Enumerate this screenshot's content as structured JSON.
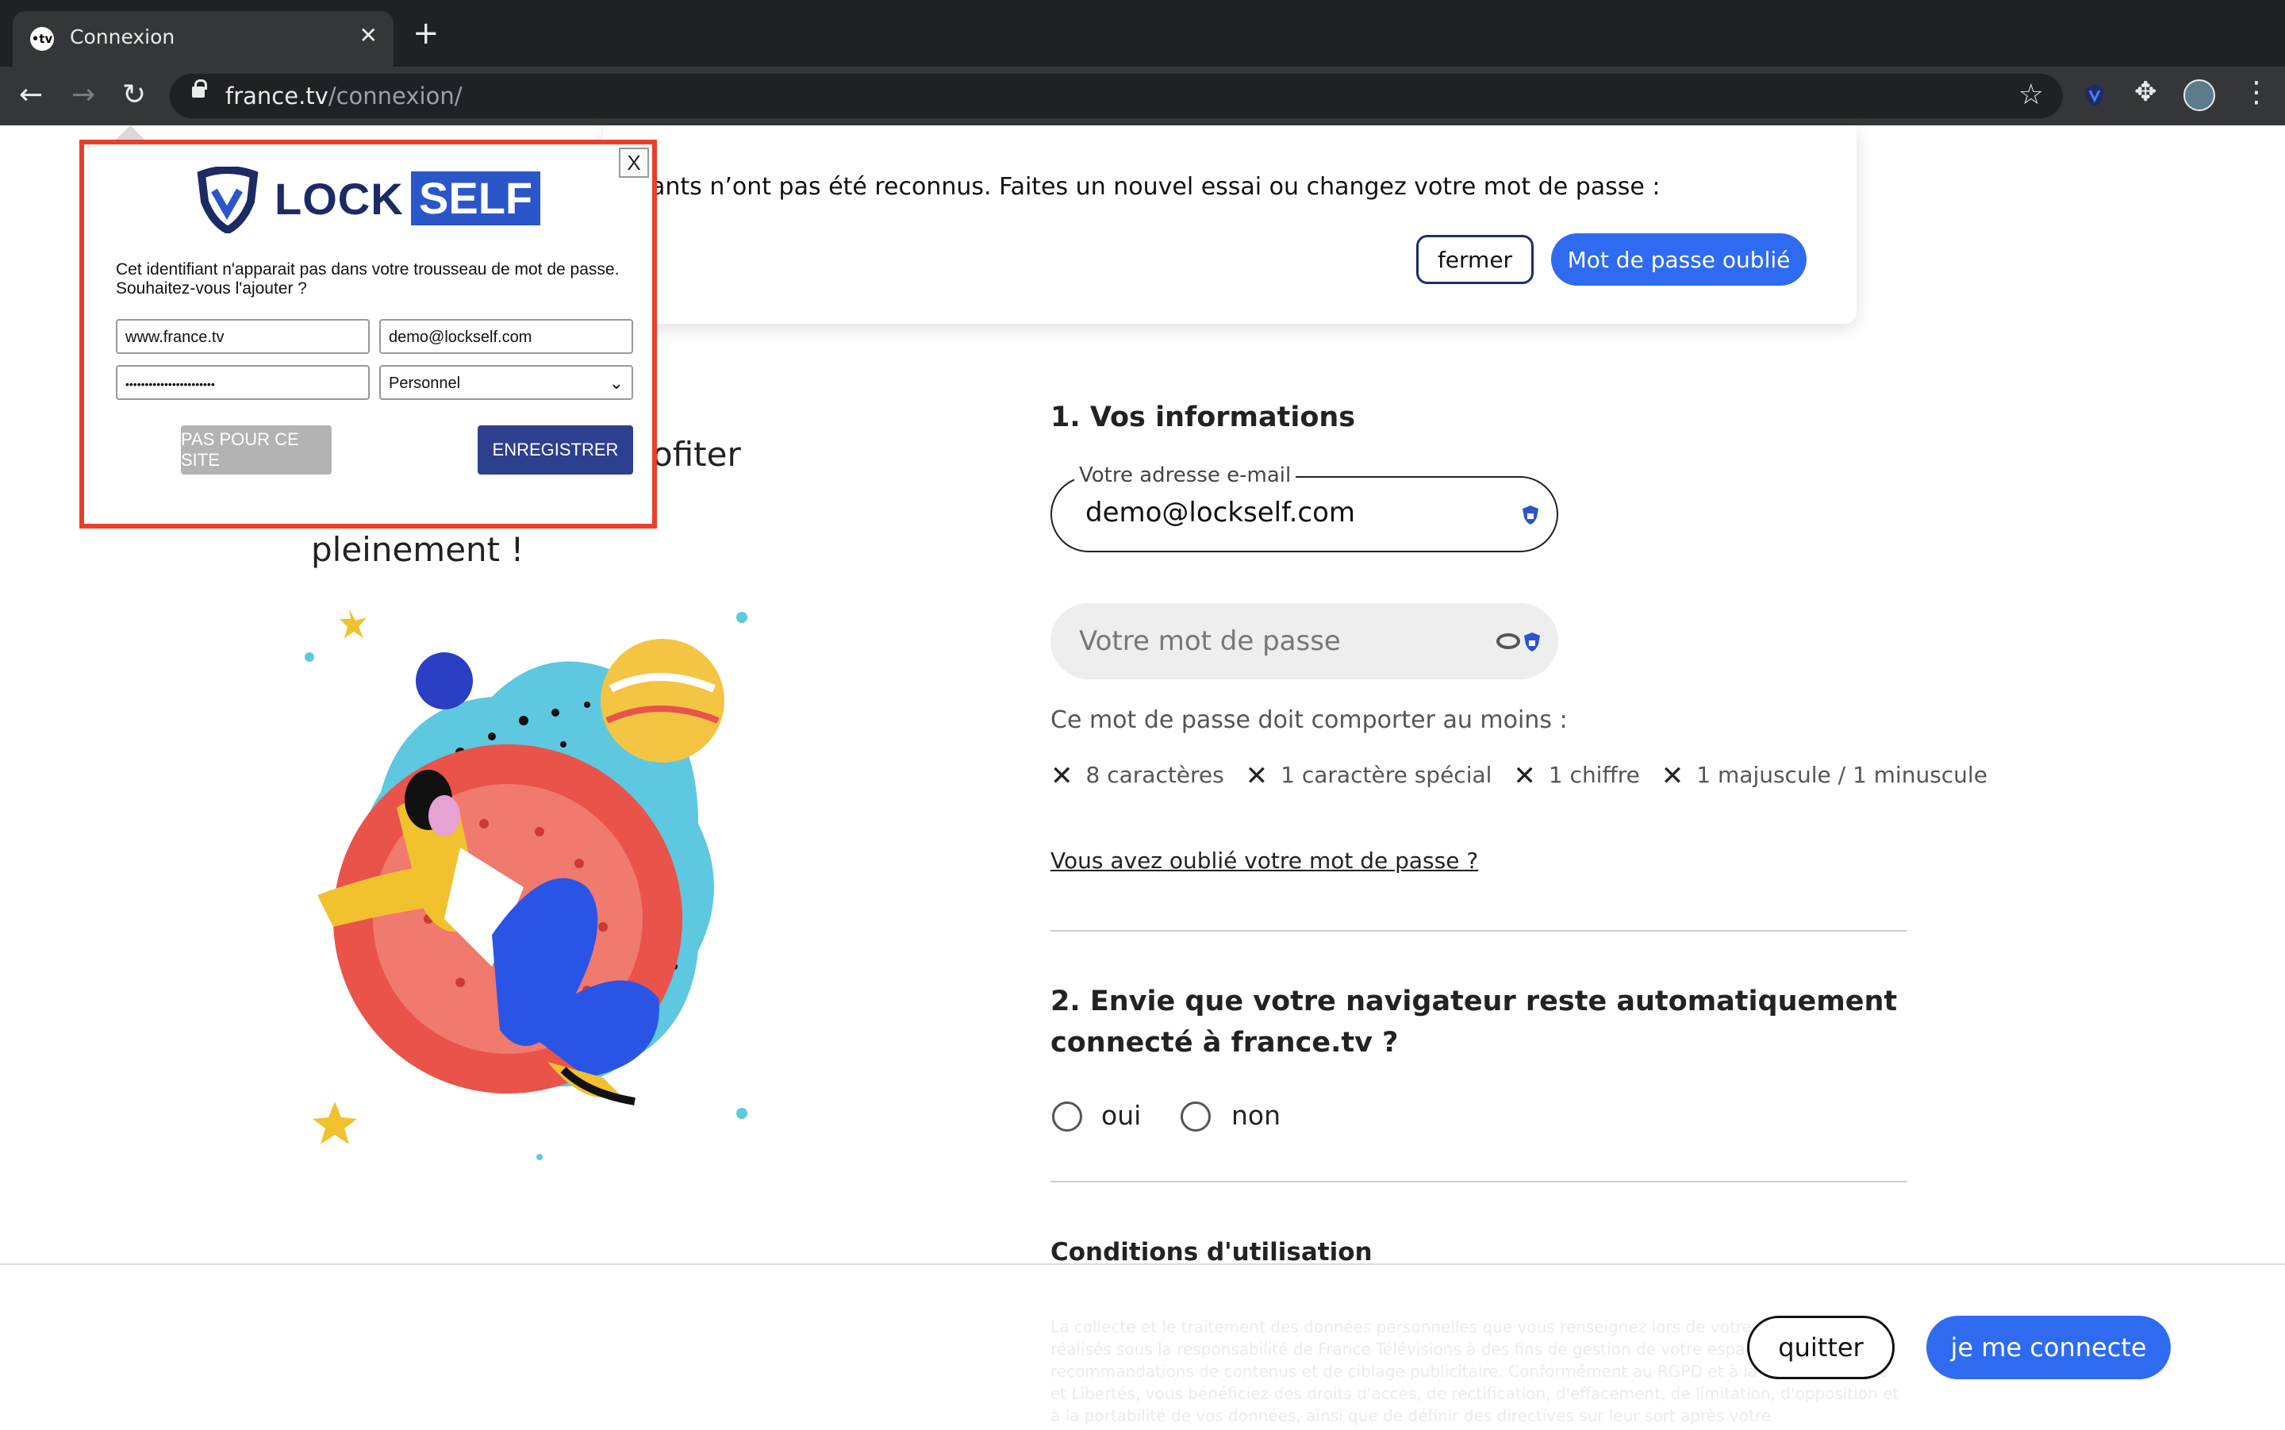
{
  "browser": {
    "tab_title": "Connexion",
    "favicon_text": "•tv",
    "url_host": "france.tv",
    "url_path": "/connexion/"
  },
  "alert": {
    "message": "ants n’ont pas été reconnus. Faites un nouvel essai ou changez votre mot de passe :",
    "close_label": "fermer",
    "forgot_label": "Mot de passe oublié"
  },
  "left": {
    "heading_line1": "ofiter",
    "heading_line2": "pleinement !"
  },
  "form": {
    "section1_title": "1. Vos informations",
    "email_label": "Votre adresse e-mail",
    "email_value": "demo@lockself.com",
    "password_placeholder": "Votre mot de passe",
    "rules_title": "Ce mot de passe doit comporter au moins :",
    "rules": [
      "8 caractères",
      "1 caractère spécial",
      "1 chiffre",
      "1 majuscule / 1 minuscule"
    ],
    "forgot_link": "Vous avez oublié votre mot de passe ?",
    "section2_title": "2. Envie que votre navigateur reste automatiquement connecté à france.tv ?",
    "radio_yes": "oui",
    "radio_no": "non",
    "conditions_title": "Conditions d'utilisation"
  },
  "footer": {
    "legal_text": "La collecte et le traitement des données personnelles que vous renseignez lors de votre inscription sont réalisés sous la responsabilité de France Télévisions à des fins de gestion de votre espace personnel, de recommandations de contenus et de ciblage publicitaire. Conformément au RGPD et à la loi Informatique et Libertés, vous bénéficiez des droits d'accès, de rectification, d'effacement, de limitation, d'opposition et à la portabilité de vos données, ainsi que de définir des directives sur leur sort après votre",
    "quit_label": "quitter",
    "connect_label": "je me connecte"
  },
  "lockself": {
    "logo_lock": "LOCK",
    "logo_self": "SELF",
    "close_label": "X",
    "message": "Cet identifiant n'apparait pas dans votre trousseau de mot de passe. Souhaitez-vous l'ajouter ?",
    "site_value": "www.france.tv",
    "login_value": "demo@lockself.com",
    "password_value": "•••••••••••••••••••••••",
    "folder_value": "Personnel",
    "not_site_label": "PAS POUR CE SITE",
    "save_label": "ENREGISTRER"
  },
  "colors": {
    "accent_blue": "#2f6bf0",
    "popup_border": "#e8402b",
    "lockself_navy": "#2e3f8f"
  },
  "icons": [
    "back-arrow-icon",
    "forward-arrow-icon",
    "reload-icon",
    "lock-icon",
    "star-icon",
    "lockself-extension-icon",
    "puzzle-icon",
    "profile-avatar",
    "kebab-menu-icon",
    "close-icon",
    "shield-icon",
    "eye-icon",
    "x-mark-icon"
  ]
}
